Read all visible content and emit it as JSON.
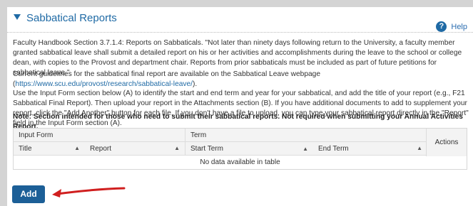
{
  "section": {
    "title": "Sabbatical Reports",
    "help_label": "Help"
  },
  "body": {
    "paragraph1": "Faculty Handbook Section 3.7.1.4: Reports on Sabbaticals.  \"Not later than ninety days following return to the University, a faculty member granted sabbatical leave shall submit a detailed report on his or her activities and accomplishments during the leave to the school or college dean, with copies to the Provost and department chair.  Reports from prior sabbaticals must be included as part of future petitions for sabbatical leave.\"",
    "paragraph2_text": "Current guidelines for the sabbatical final report are available on the Sabbatical Leave webpage (",
    "paragraph2_link": "https://www.scu.edu/provost/research/sabbatical-leave/",
    "paragraph2_end": ").",
    "paragraph3": "Use the Input Form section below (A) to identify the start and end term and year for your sabbatical, and add the title of your report (e.g., F21 Sabbatical Final Report). Then upload your report in the Attachments section (B). If you have additional documents to add to supplement your report, click the \"Add Another\" button for each file. If you don't have a file to upload, you can type your sabbatical report directly in the \"Report\" field in the Input Form section (A).",
    "note": "Note: Section intended for those who need to submit their sabbatical reports. Not required when submitting your Annual Activities Report."
  },
  "table": {
    "group_input_form": "Input Form",
    "group_term": "Term",
    "actions": "Actions",
    "columns": [
      "Title",
      "Report",
      "Start Term",
      "End Term"
    ],
    "empty_message": "No data available in table"
  },
  "buttons": {
    "add": "Add"
  },
  "colors": {
    "accent": "#1f6aa5",
    "button": "#1c5f97",
    "arrow": "#d01f1f"
  }
}
